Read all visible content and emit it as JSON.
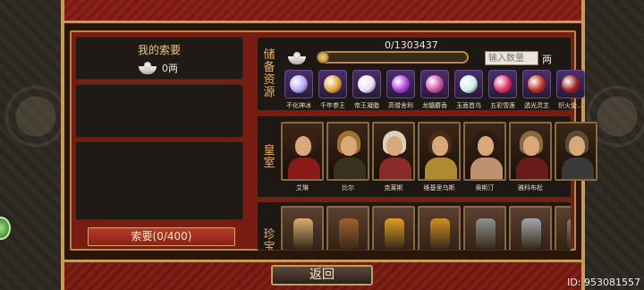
{
  "my_request": {
    "title": "我的索要",
    "amount": "0两",
    "amount_icon": "silver-ingot-icon"
  },
  "request_button_label": "索要(0/400)",
  "resource": {
    "label": "储备资源",
    "counter": "0/1303437",
    "progress_fraction": 0,
    "input_placeholder": "输入数量",
    "unit": "两",
    "items": [
      {
        "name": "不化神冰",
        "icon": "ice-orb-icon",
        "color": "#b8a8f0"
      },
      {
        "name": "千年参王",
        "icon": "ginseng-icon",
        "color": "#e0a030"
      },
      {
        "name": "帝王凝脂",
        "icon": "cream-jar-icon",
        "color": "#e8e0f0"
      },
      {
        "name": "高僧舍利",
        "icon": "relic-pearl-icon",
        "color": "#b040e0"
      },
      {
        "name": "龙髓麝香",
        "icon": "musk-pouch-icon",
        "color": "#d050a0"
      },
      {
        "name": "玉面首乌",
        "icon": "jade-root-icon",
        "color": "#c8f0e8"
      },
      {
        "name": "五彩雪莲",
        "icon": "snow-lotus-icon",
        "color": "#e03060"
      },
      {
        "name": "透光灵芝",
        "icon": "lingzhi-icon",
        "color": "#c03020"
      },
      {
        "name": "炽火金...",
        "icon": "fire-gold-icon",
        "color": "#a02020"
      }
    ]
  },
  "royal": {
    "label": "皇室",
    "members": [
      {
        "name": "艾琳",
        "hair": "#3a2010",
        "outfit": "#8a1a1a"
      },
      {
        "name": "比尔",
        "hair": "#a07030",
        "outfit": "#3a3020"
      },
      {
        "name": "克莱斯",
        "hair": "#d8d0c0",
        "outfit": "#8a2a2a"
      },
      {
        "name": "维基里乌斯",
        "hair": "#4a2a14",
        "outfit": "#b08a30"
      },
      {
        "name": "奥斯汀",
        "hair": "#2a1a10",
        "outfit": "#c09070"
      },
      {
        "name": "雅科布松",
        "hair": "#8a6a40",
        "outfit": "#6a1a1a"
      },
      {
        "name": "",
        "hair": "#5a4a3a",
        "outfit": "#3a3a3a"
      }
    ]
  },
  "treasure": {
    "label": "珍宝",
    "items": [
      {
        "icon": "scroll-book-icon",
        "color": "#d8b070"
      },
      {
        "icon": "egg-icon",
        "color": "#a06030"
      },
      {
        "icon": "golden-seal-icon",
        "color": "#e0a020"
      },
      {
        "icon": "golden-shrine-icon",
        "color": "#d09020"
      },
      {
        "icon": "sword-icon",
        "color": "#909090"
      },
      {
        "icon": "elephant-statue-icon",
        "color": "#a0a8b0"
      },
      {
        "icon": "partial-item-icon",
        "color": "#8a7a6a"
      }
    ]
  },
  "back_button_label": "返回",
  "id_text": "ID: 953081557"
}
